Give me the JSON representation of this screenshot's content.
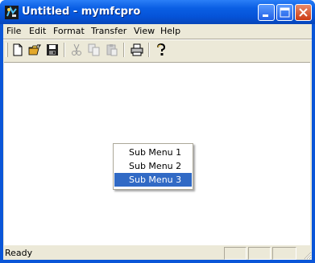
{
  "window": {
    "title": "Untitled - mymfcpro"
  },
  "menubar": {
    "items": [
      {
        "label": "File"
      },
      {
        "label": "Edit"
      },
      {
        "label": "Format"
      },
      {
        "label": "Transfer"
      },
      {
        "label": "View"
      },
      {
        "label": "Help"
      }
    ]
  },
  "toolbar": {
    "buttons": [
      {
        "icon": "new-document-icon",
        "enabled": true
      },
      {
        "icon": "open-folder-icon",
        "enabled": true
      },
      {
        "icon": "save-icon",
        "enabled": true
      },
      {
        "icon": "cut-icon",
        "enabled": false
      },
      {
        "icon": "copy-icon",
        "enabled": false
      },
      {
        "icon": "paste-icon",
        "enabled": false
      },
      {
        "icon": "print-icon",
        "enabled": true
      },
      {
        "icon": "help-icon",
        "enabled": true
      }
    ]
  },
  "context_menu": {
    "items": [
      {
        "label": "Sub Menu 1",
        "selected": false
      },
      {
        "label": "Sub Menu 2",
        "selected": false
      },
      {
        "label": "Sub Menu 3",
        "selected": true
      }
    ]
  },
  "statusbar": {
    "text": "Ready"
  },
  "colors": {
    "title_bar": "#0a5ee3",
    "selection": "#316ac5",
    "chrome": "#ece9d8"
  }
}
